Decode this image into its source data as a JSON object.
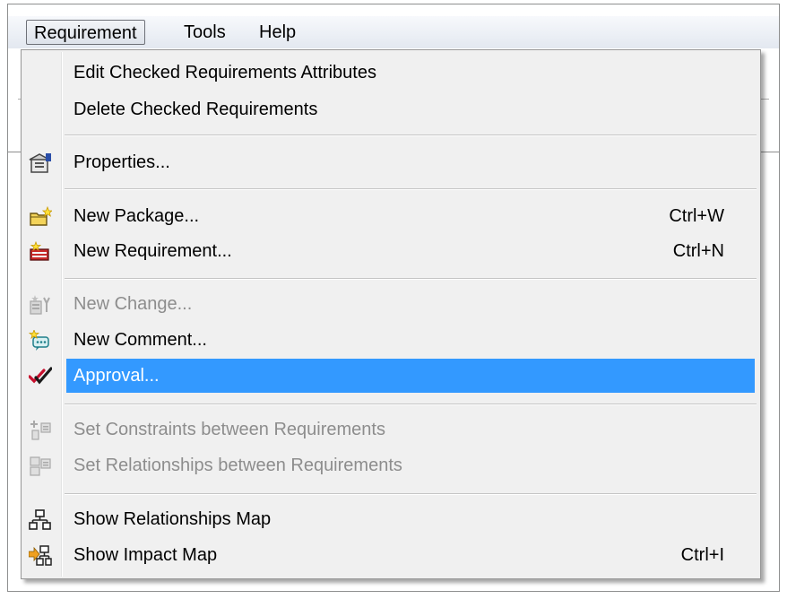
{
  "menubar": {
    "items": [
      {
        "label": "Requirement"
      },
      {
        "label": "Tools"
      },
      {
        "label": "Help"
      }
    ]
  },
  "menu": {
    "edit_checked": {
      "label": "Edit Checked Requirements Attributes"
    },
    "delete_checked": {
      "label": "Delete Checked Requirements"
    },
    "properties": {
      "label": "Properties...",
      "icon": "properties-icon"
    },
    "new_package": {
      "label": "New Package...",
      "shortcut": "Ctrl+W",
      "icon": "new-package-icon"
    },
    "new_requirement": {
      "label": "New Requirement...",
      "shortcut": "Ctrl+N",
      "icon": "new-requirement-icon"
    },
    "new_change": {
      "label": "New Change...",
      "icon": "new-change-icon",
      "disabled": true
    },
    "new_comment": {
      "label": "New Comment...",
      "icon": "new-comment-icon"
    },
    "approval": {
      "label": "Approval...",
      "icon": "approval-checkmark-icon",
      "highlighted": true
    },
    "set_constraints": {
      "label": "Set Constraints between Requirements",
      "icon": "constraints-icon",
      "disabled": true
    },
    "set_relationships": {
      "label": "Set Relationships between Requirements",
      "icon": "relationships-icon",
      "disabled": true
    },
    "show_relationships_map": {
      "label": "Show Relationships Map",
      "icon": "relationships-map-icon"
    },
    "show_impact_map": {
      "label": "Show Impact Map",
      "shortcut": "Ctrl+I",
      "icon": "impact-map-icon"
    }
  },
  "colors": {
    "highlight": "#3399ff",
    "menu_background": "#f0f0f0",
    "disabled_text": "#8d8d8d"
  }
}
